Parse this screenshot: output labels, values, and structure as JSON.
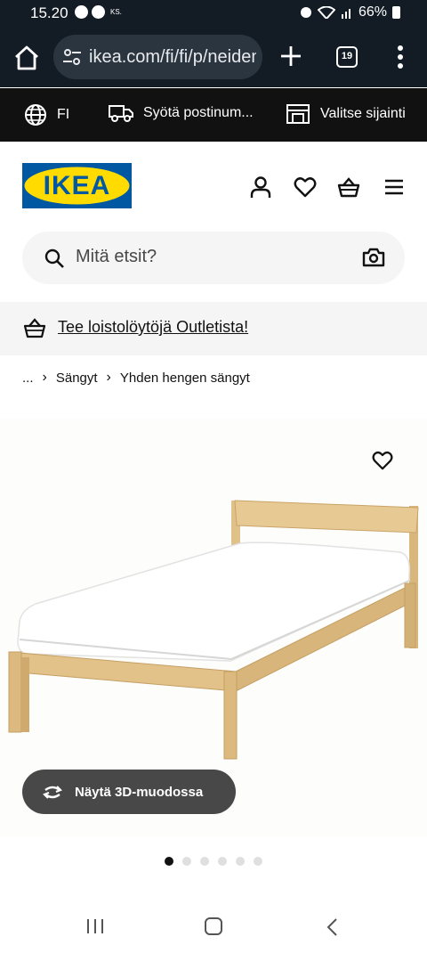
{
  "status_bar": {
    "time": "15.20",
    "small_label": "KS.",
    "battery": "66%"
  },
  "browser": {
    "url": "ikea.com/fi/fi/p/neiden-sangynrunko-manty",
    "tab_count": "19"
  },
  "utility_bar": {
    "language": "FI",
    "postal_code": "Syötä postinum...",
    "store": "Valitse sijainti"
  },
  "header": {
    "logo_text": "IKEA"
  },
  "search": {
    "placeholder": "Mitä etsit?"
  },
  "promo": {
    "text": "Tee loistolöytöjä Outletista!"
  },
  "breadcrumb": {
    "ellipsis": "...",
    "items": [
      "Sängyt",
      "Yhden hengen sängyt"
    ]
  },
  "product": {
    "view_3d_label": "Näytä 3D-muodossa"
  },
  "carousel": {
    "count": 6,
    "active_index": 0
  },
  "colors": {
    "ikea_blue": "#0058a3",
    "ikea_yellow": "#ffdb00",
    "dark_bar": "#131c25"
  }
}
